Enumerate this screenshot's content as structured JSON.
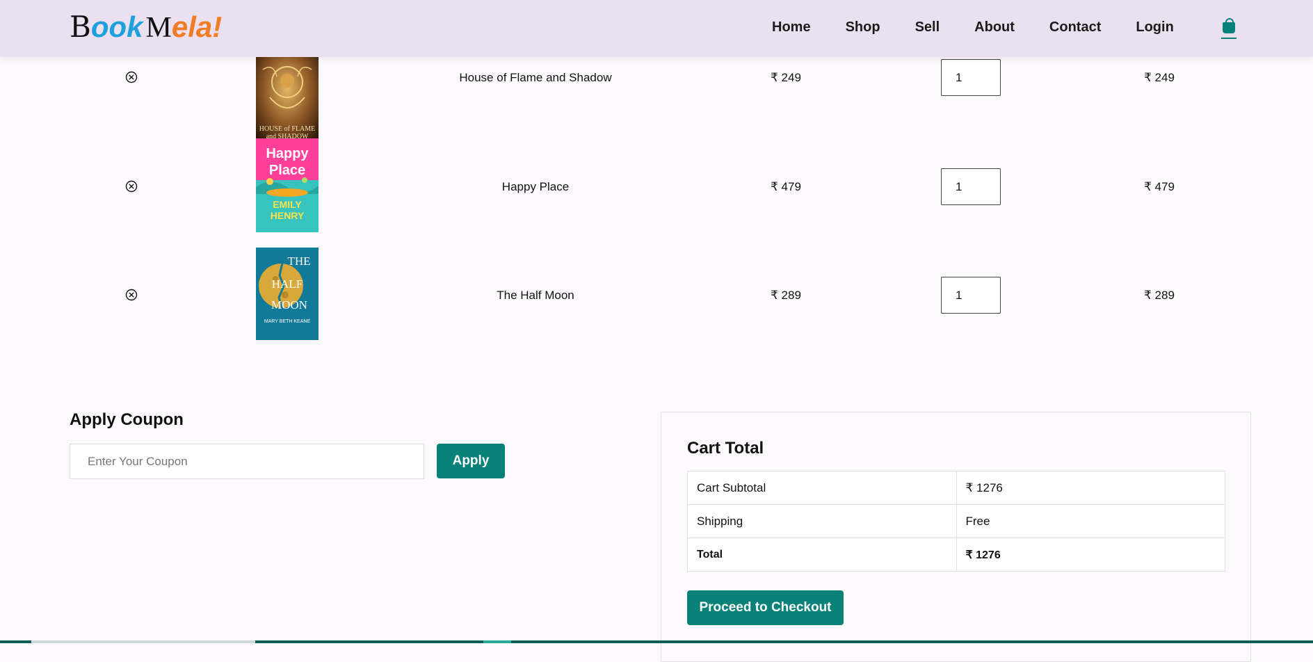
{
  "header": {
    "logo": {
      "part1": "B",
      "part2": "ook",
      "part3": "M",
      "part4": "ela!"
    },
    "nav": [
      "Home",
      "Shop",
      "Sell",
      "About",
      "Contact",
      "Login"
    ],
    "cart_icon": "shopping-bag-icon",
    "accent_color": "#088178",
    "background_color": "#ebe0f0"
  },
  "cart": {
    "items": [
      {
        "name": "House of Flame and Shadow",
        "price": "₹ 249",
        "quantity": "1",
        "subtotal": "₹ 249",
        "cover": {
          "lines": [
            "HOUSE of FLAME",
            "and SHADOW"
          ],
          "bg": "#3b2410",
          "accent": "#d4a24a"
        }
      },
      {
        "name": "Happy Place",
        "price": "₹ 479",
        "quantity": "1",
        "subtotal": "₹ 479",
        "cover": {
          "lines": [
            "Happy",
            "Place",
            "EMILY",
            "HENRY"
          ],
          "bg": "#ff3f9a",
          "accent": "#3cc8c0"
        }
      },
      {
        "name": "The Half Moon",
        "price": "₹ 289",
        "quantity": "1",
        "subtotal": "₹ 289",
        "cover": {
          "lines": [
            "THE",
            "HALF",
            "MOON",
            "MARY BETH KEANE"
          ],
          "bg": "#127a99",
          "accent": "#d8a83a"
        }
      }
    ],
    "remove_icon": "close-circle-icon"
  },
  "coupon": {
    "title": "Apply Coupon",
    "placeholder": "Enter Your Coupon",
    "button": "Apply"
  },
  "totals": {
    "title": "Cart Total",
    "rows": [
      {
        "label": "Cart Subtotal",
        "value": "₹ 1276"
      },
      {
        "label": "Shipping",
        "value": "Free"
      },
      {
        "label": "Total",
        "value": "₹ 1276"
      }
    ],
    "checkout_button": "Proceed to Checkout"
  }
}
